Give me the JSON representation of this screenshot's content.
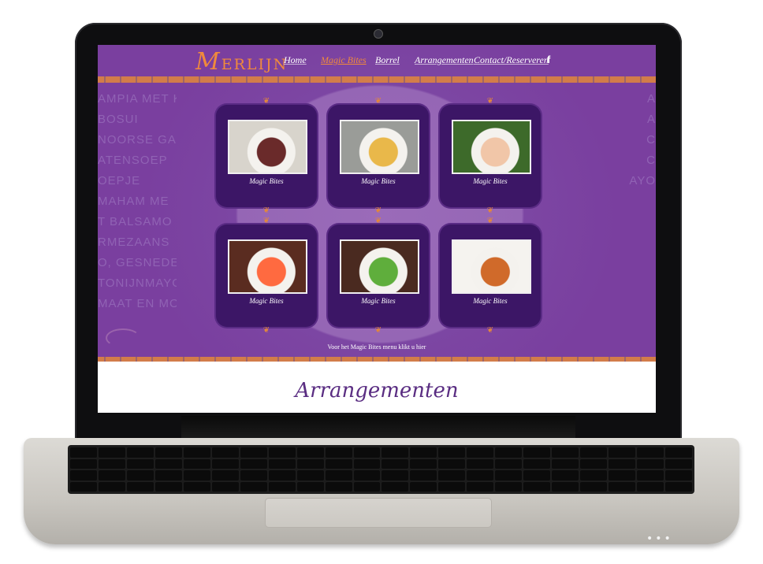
{
  "site": {
    "logo_initial": "M",
    "logo_rest": "ERLIJN",
    "nav": [
      {
        "label": "Home"
      },
      {
        "label": "Magic Bites"
      },
      {
        "label": "Borrel"
      },
      {
        "label": "Arrangementen"
      },
      {
        "label": "Contact/Reserveren"
      }
    ],
    "facebook_glyph": "f"
  },
  "hero": {
    "menu_left": [
      "AMPIA MET KER",
      "BOSUI",
      "NOORSE GA",
      "ATENSOEP",
      "OEPJE",
      "MAHAM ME",
      "T BALSAMO",
      "RMEZAANS",
      "O, GESNEDE",
      "TONIJNMAYO",
      "MAAT EN MOZZ"
    ],
    "menu_right": [
      "A",
      "A",
      "C",
      "C",
      "",
      "",
      "",
      "",
      "AYO"
    ],
    "cards": [
      {
        "caption": "Magic Bites",
        "photo_bg": "#d8d4cc",
        "food": "#6a2a2a"
      },
      {
        "caption": "Magic Bites",
        "photo_bg": "#9a9c98",
        "food": "#e9b84a"
      },
      {
        "caption": "Magic Bites",
        "photo_bg": "#3d6a2a",
        "food": "#f1c6a8"
      },
      {
        "caption": "Magic Bites",
        "photo_bg": "#5a2c20",
        "food": "#ff6a40"
      },
      {
        "caption": "Magic Bites",
        "photo_bg": "#4a2a20",
        "food": "#5fae3c"
      },
      {
        "caption": "Magic Bites",
        "photo_bg": "#f5f3ef",
        "food": "#d06a2a"
      }
    ],
    "menu_link": "Voor het Magic Bites menu klikt u hier"
  },
  "arrangementen": {
    "title": "Arrangementen"
  },
  "colors": {
    "purple": "#7a3f9f",
    "card": "#3c1666",
    "accent_orange": "#f08a3c"
  }
}
